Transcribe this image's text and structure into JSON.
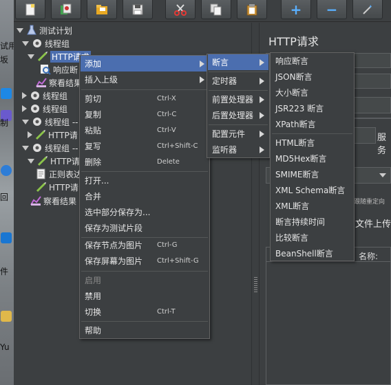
{
  "desktop_strip": {
    "fragments": [
      "试用",
      "坂",
      "制",
      "回",
      "件",
      "Yu"
    ]
  },
  "toolbar": {
    "buttons": [
      {
        "icon": "new-document-icon"
      },
      {
        "icon": "templates-icon"
      },
      {
        "icon": "open-folder-icon"
      },
      {
        "icon": "save-icon"
      },
      {
        "icon": "cut-icon"
      },
      {
        "icon": "copy-icon"
      },
      {
        "icon": "paste-icon"
      },
      {
        "icon": "expand-plus-icon",
        "glyph": "+"
      },
      {
        "icon": "collapse-minus-icon",
        "glyph": "−"
      },
      {
        "icon": "toggle-wand-icon"
      }
    ]
  },
  "tree": {
    "nodes": [
      {
        "label": "测试计划",
        "icon": "test-plan-icon"
      },
      {
        "label": "线程组",
        "icon": "thread-group-gear-icon"
      },
      {
        "label": "HTTP请求",
        "icon": "http-sampler-pen-icon"
      },
      {
        "label": "响应断",
        "icon": "response-assertion-magnifier-icon"
      },
      {
        "label": "察看结果",
        "icon": "view-results-graph-icon"
      },
      {
        "label": "线程组",
        "icon": "thread-group-gear-icon"
      },
      {
        "label": "线程组",
        "icon": "thread-group-gear-icon"
      },
      {
        "label": "线程组 --",
        "icon": "thread-group-gear-icon"
      },
      {
        "label": "HTTP请",
        "icon": "http-sampler-pen-icon"
      },
      {
        "label": "线程组 --",
        "icon": "thread-group-gear-icon"
      },
      {
        "label": "HTTP请",
        "icon": "http-sampler-pen-icon"
      },
      {
        "label": "正则表达",
        "icon": "regex-extractor-doc-icon"
      },
      {
        "label": "HTTP请",
        "icon": "http-sampler-pen-icon"
      },
      {
        "label": "察看结果",
        "icon": "view-results-graph-icon"
      }
    ]
  },
  "right_panel": {
    "title": "HTTP请求",
    "server_label": "服务",
    "redirect_label": "跟随重定向",
    "file_upload_label": "文件上传",
    "name_label": "名称:"
  },
  "context_menu": {
    "items": [
      {
        "label": "添加",
        "submenu": true,
        "highlighted": true
      },
      {
        "label": "插入上级",
        "submenu": true
      },
      {
        "label": "剪切",
        "shortcut": "Ctrl-X"
      },
      {
        "label": "复制",
        "shortcut": "Ctrl-C"
      },
      {
        "label": "粘贴",
        "shortcut": "Ctrl-V"
      },
      {
        "label": "复写",
        "shortcut": "Ctrl+Shift-C"
      },
      {
        "label": "删除",
        "shortcut": "Delete"
      },
      {
        "label": "打开..."
      },
      {
        "label": "合并"
      },
      {
        "label": "选中部分保存为..."
      },
      {
        "label": "保存为测试片段"
      },
      {
        "label": "保存节点为图片",
        "shortcut": "Ctrl-G"
      },
      {
        "label": "保存屏幕为图片",
        "shortcut": "Ctrl+Shift-G"
      },
      {
        "label": "启用",
        "disabled": true
      },
      {
        "label": "禁用"
      },
      {
        "label": "切换",
        "shortcut": "Ctrl-T"
      },
      {
        "label": "帮助"
      }
    ]
  },
  "add_submenu": {
    "items": [
      {
        "label": "断言",
        "highlighted": true
      },
      {
        "label": "定时器"
      },
      {
        "label": "前置处理器"
      },
      {
        "label": "后置处理器"
      },
      {
        "label": "配置元件"
      },
      {
        "label": "监听器"
      }
    ]
  },
  "assertion_submenu": {
    "items": [
      "响应断言",
      "JSON断言",
      "大小断言",
      "JSR223 断言",
      "XPath断言",
      "HTML断言",
      "MD5Hex断言",
      "SMIME断言",
      "XML Schema断言",
      "XML断言",
      "断言持续时间",
      "比较断言",
      "BeanShell断言"
    ]
  },
  "colors": {
    "background": "#3c3f41",
    "selection": "#4b6eaf",
    "menu_border": "#646464",
    "text": "#e6e6e6"
  }
}
